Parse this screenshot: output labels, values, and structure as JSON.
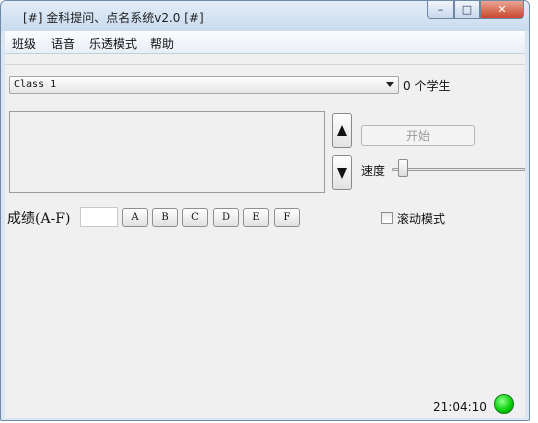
{
  "window": {
    "title": "[#] 金科提问、点名系统v2.0 [#]",
    "minimize_symbol": "–",
    "maximize_symbol": "□",
    "close_symbol": "✕"
  },
  "menu": {
    "items": [
      "班级",
      "语音",
      "乐透模式",
      "帮助"
    ]
  },
  "class_select": {
    "selected": "Class 1"
  },
  "student_count": "0 个学生",
  "controls": {
    "start_label": "开始",
    "speed_label": "速度",
    "speed_level": 0.08
  },
  "grade": {
    "label": "成绩(A-F)",
    "input_value": "",
    "buttons": [
      "A",
      "B",
      "C",
      "D",
      "E",
      "F"
    ]
  },
  "scroll_mode": {
    "label": "滚动模式",
    "checked": false
  },
  "status": {
    "time": "21:04:10",
    "indicator_color": "#00cc00"
  }
}
